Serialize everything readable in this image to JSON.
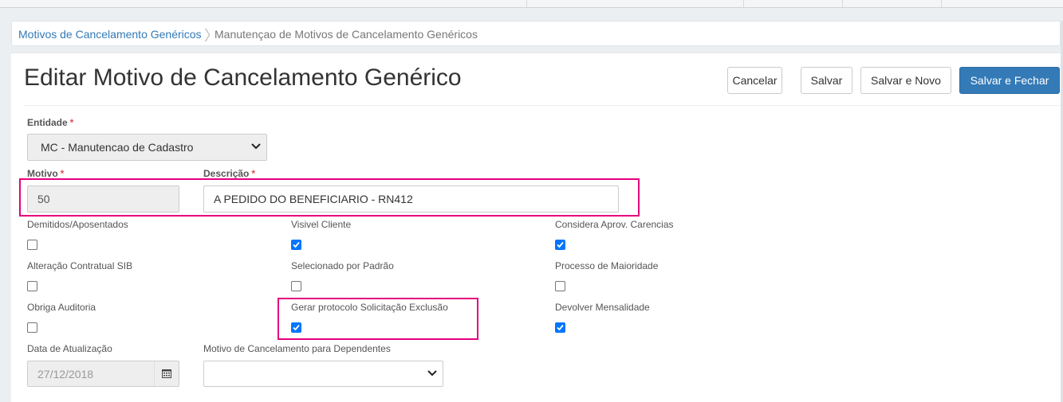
{
  "breadcrumb": {
    "parent": "Motivos de Cancelamento Genéricos",
    "separator": "〉",
    "current": "Manutençao de Motivos de Cancelamento Genéricos"
  },
  "page": {
    "title": "Editar Motivo de Cancelamento Genérico"
  },
  "toolbar": {
    "cancel": "Cancelar",
    "save": "Salvar",
    "save_new": "Salvar e Novo",
    "save_close": "Salvar e Fechar"
  },
  "colors": {
    "primary": "#337ab7",
    "checkbox": "#0075ff",
    "highlight": "#e6007e"
  },
  "form": {
    "required_mark": "*",
    "entidade": {
      "label": "Entidade",
      "value": "MC - Manutencao de Cadastro"
    },
    "motivo": {
      "label": "Motivo",
      "value": "50"
    },
    "descricao": {
      "label": "Descrição",
      "value": "A PEDIDO DO BENEFICIARIO - RN412"
    },
    "checkboxes": [
      {
        "label": "Demitidos/Aposentados",
        "checked": false
      },
      {
        "label": "Visivel Cliente",
        "checked": true
      },
      {
        "label": "Considera Aprov. Carencias",
        "checked": true
      },
      {
        "label": "Alteração Contratual SIB",
        "checked": false
      },
      {
        "label": "Selecionado por Padrão",
        "checked": false
      },
      {
        "label": "Processo de Maioridade",
        "checked": false
      },
      {
        "label": "Obriga Auditoria",
        "checked": false
      },
      {
        "label": "Gerar protocolo Solicitação Exclusão",
        "checked": true
      },
      {
        "label": "Devolver Mensalidade",
        "checked": true
      }
    ],
    "data_atualizacao": {
      "label": "Data de Atualização",
      "value": "27/12/2018",
      "icon": "calendar-icon"
    },
    "motivo_dependentes": {
      "label": "Motivo de Cancelamento para Dependentes",
      "value": ""
    }
  }
}
